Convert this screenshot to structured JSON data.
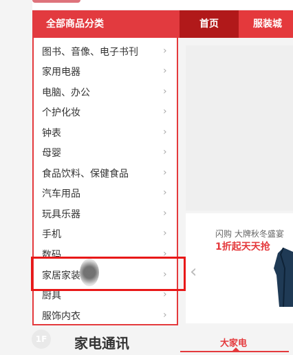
{
  "nav": {
    "category_title": "全部商品分类",
    "tabs": [
      {
        "label": "首页"
      },
      {
        "label": "服装城"
      }
    ]
  },
  "categories": [
    {
      "label": "图书、音像、电子书刊"
    },
    {
      "label": "家用电器"
    },
    {
      "label": "电脑、办公"
    },
    {
      "label": "个护化妆"
    },
    {
      "label": "钟表"
    },
    {
      "label": "母婴"
    },
    {
      "label": "食品饮料、保健食品"
    },
    {
      "label": "汽车用品"
    },
    {
      "label": "玩具乐器"
    },
    {
      "label": "手机"
    },
    {
      "label": "数码"
    },
    {
      "label": "家居家装"
    },
    {
      "label": "厨具"
    },
    {
      "label": "服饰内衣"
    }
  ],
  "promo": {
    "subtitle": "闪购   大牌秋冬盛宴",
    "headline": "1折起天天抢"
  },
  "floor": {
    "badge": "1F",
    "title": "家电通讯",
    "tab": "大家电"
  },
  "colors": {
    "accent": "#e4393c",
    "highlight_box": "#e81818"
  }
}
